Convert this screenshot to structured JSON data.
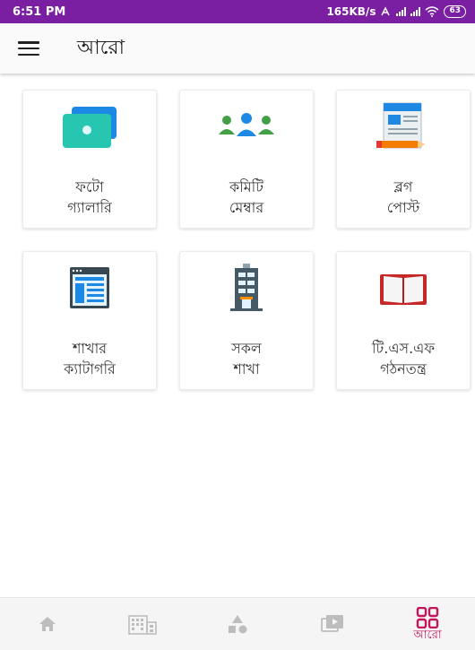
{
  "status_bar": {
    "time": "6:51 PM",
    "network_speed": "165KB/s",
    "battery": "63"
  },
  "app_bar": {
    "title": "আরো",
    "menu_icon": "hamburger-menu-icon"
  },
  "menu_items": [
    {
      "label": "ফটো\nগ্যালারি",
      "icon": "photo-gallery-icon"
    },
    {
      "label": "কমিটি\nমেম্বার",
      "icon": "committee-members-icon"
    },
    {
      "label": "ব্লগ\nপোস্ট",
      "icon": "blog-post-icon"
    },
    {
      "label": "শাখার\nক্যাটাগরি",
      "icon": "branch-category-icon"
    },
    {
      "label": "সকল\nশাখা",
      "icon": "all-branches-icon"
    },
    {
      "label": "টি.এস.এফ\nগঠনতন্ত্র",
      "icon": "constitution-book-icon"
    }
  ],
  "bottom_nav": {
    "items": [
      {
        "icon": "home-icon",
        "label": ""
      },
      {
        "icon": "building-icon",
        "label": ""
      },
      {
        "icon": "shapes-icon",
        "label": ""
      },
      {
        "icon": "video-icon",
        "label": ""
      },
      {
        "icon": "more-grid-icon",
        "label": "আরো",
        "active": true
      }
    ],
    "active_color": "#c2185b",
    "inactive_color": "#bdbdbd"
  },
  "colors": {
    "status_bar": "#7b1fa2",
    "accent": "#c2185b"
  }
}
